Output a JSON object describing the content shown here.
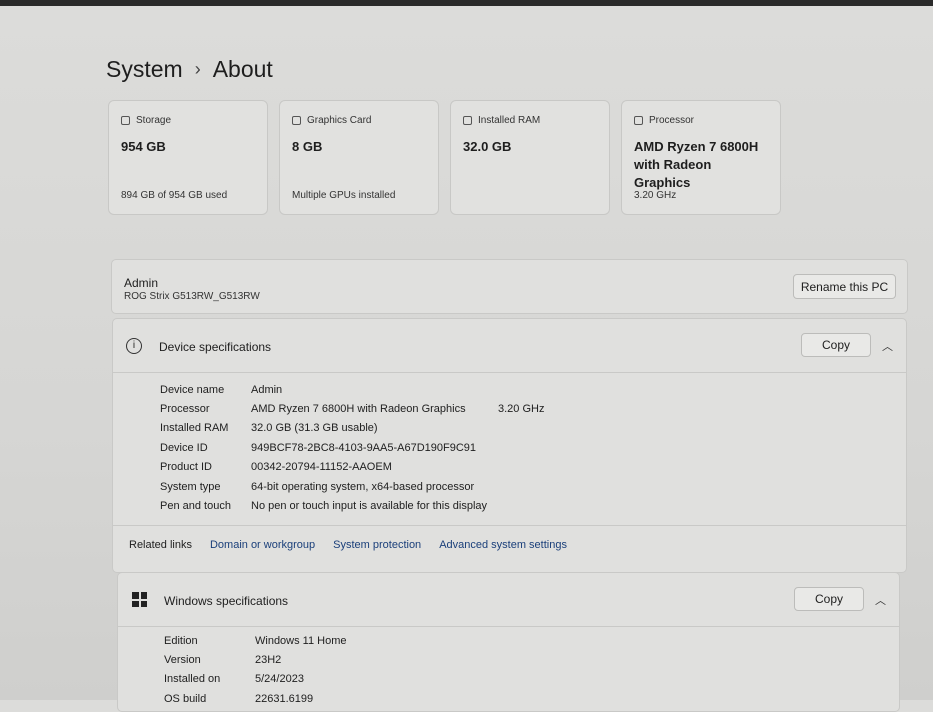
{
  "breadcrumb": {
    "parent": "System",
    "current": "About"
  },
  "cards": [
    {
      "label": "Storage",
      "value": "954 GB",
      "sub": "894 GB of 954 GB used",
      "icon": "storage-icon"
    },
    {
      "label": "Graphics Card",
      "value": "8 GB",
      "sub": "Multiple GPUs installed",
      "icon": "graphics-card-icon"
    },
    {
      "label": "Installed RAM",
      "value": "32.0 GB",
      "sub": "",
      "icon": "ram-icon"
    },
    {
      "label": "Processor",
      "value": "AMD Ryzen 7 6800H with Radeon Graphics",
      "sub": "3.20 GHz",
      "icon": "processor-icon"
    }
  ],
  "pc": {
    "name": "Admin",
    "model": "ROG Strix G513RW_G513RW",
    "rename_label": "Rename this PC"
  },
  "device_specs": {
    "title": "Device specifications",
    "copy_label": "Copy",
    "rows": [
      {
        "k": "Device name",
        "v": "Admin",
        "extra": ""
      },
      {
        "k": "Processor",
        "v": "AMD Ryzen 7 6800H with Radeon Graphics",
        "extra": "3.20 GHz"
      },
      {
        "k": "Installed RAM",
        "v": "32.0 GB (31.3 GB usable)",
        "extra": ""
      },
      {
        "k": "Device ID",
        "v": "949BCF78-2BC8-4103-9AA5-A67D190F9C91",
        "extra": ""
      },
      {
        "k": "Product ID",
        "v": "00342-20794-11152-AAOEM",
        "extra": ""
      },
      {
        "k": "System type",
        "v": "64-bit operating system, x64-based processor",
        "extra": ""
      },
      {
        "k": "Pen and touch",
        "v": "No pen or touch input is available for this display",
        "extra": ""
      }
    ]
  },
  "related": {
    "label": "Related links",
    "links": [
      "Domain or workgroup",
      "System protection",
      "Advanced system settings"
    ]
  },
  "windows_specs": {
    "title": "Windows specifications",
    "copy_label": "Copy",
    "rows": [
      {
        "k": "Edition",
        "v": "Windows 11 Home"
      },
      {
        "k": "Version",
        "v": "23H2"
      },
      {
        "k": "Installed on",
        "v": "5/24/2023"
      },
      {
        "k": "OS build",
        "v": "22631.6199"
      }
    ]
  }
}
